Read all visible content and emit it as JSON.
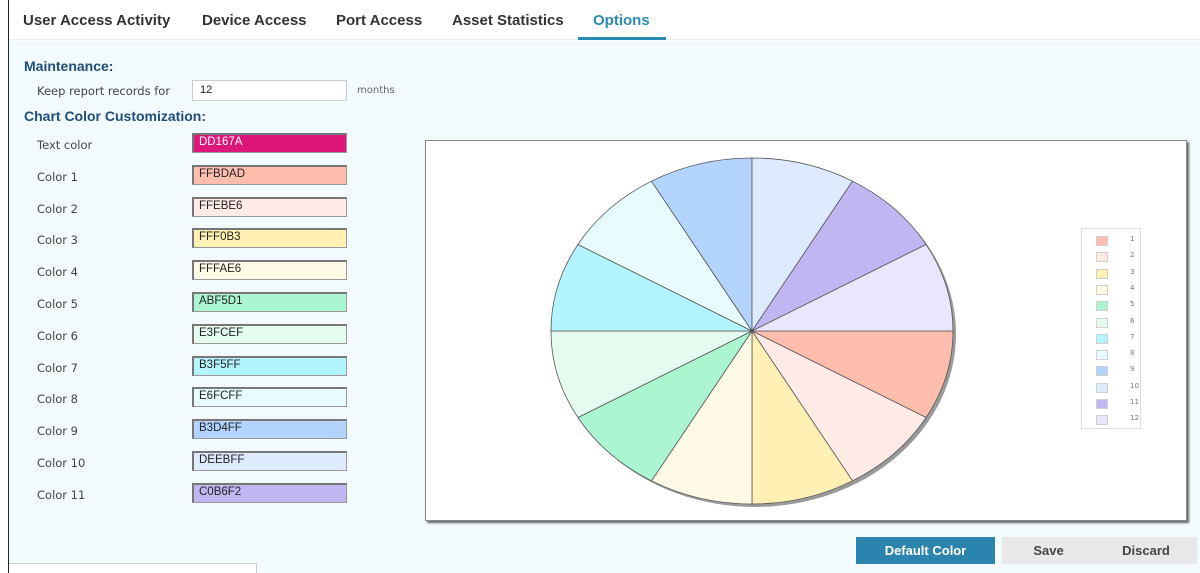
{
  "tabs": [
    {
      "label": "User Access Activity"
    },
    {
      "label": "Device Access"
    },
    {
      "label": "Port Access"
    },
    {
      "label": "Asset Statistics"
    },
    {
      "label": "Options"
    }
  ],
  "active_tab": "Options",
  "maintenance": {
    "title": "Maintenance:",
    "keep_label": "Keep report records for",
    "keep_value": "12",
    "unit": "months"
  },
  "chart_custom": {
    "title": "Chart Color Customization:",
    "text_color": {
      "label": "Text color",
      "value": "DD167A",
      "color": "#DD167A"
    },
    "colors": [
      {
        "label": "Color 1",
        "value": "FFBDAD",
        "color": "#FFBDAD"
      },
      {
        "label": "Color 2",
        "value": "FFEBE6",
        "color": "#FFEBE6"
      },
      {
        "label": "Color 3",
        "value": "FFF0B3",
        "color": "#FFF0B3"
      },
      {
        "label": "Color 4",
        "value": "FFFAE6",
        "color": "#FFFAE6"
      },
      {
        "label": "Color 5",
        "value": "ABF5D1",
        "color": "#ABF5D1"
      },
      {
        "label": "Color 6",
        "value": "E3FCEF",
        "color": "#E3FCEF"
      },
      {
        "label": "Color 7",
        "value": "B3F5FF",
        "color": "#B3F5FF"
      },
      {
        "label": "Color 8",
        "value": "E6FCFF",
        "color": "#E6FCFF"
      },
      {
        "label": "Color 9",
        "value": "B3D4FF",
        "color": "#B3D4FF"
      },
      {
        "label": "Color 10",
        "value": "DEEBFF",
        "color": "#DEEBFF"
      },
      {
        "label": "Color 11",
        "value": "C0B6F2",
        "color": "#C0B6F2"
      }
    ]
  },
  "chart_data": {
    "type": "pie",
    "categories": [
      "1",
      "2",
      "3",
      "4",
      "5",
      "6",
      "7",
      "8",
      "9",
      "10",
      "11",
      "12"
    ],
    "values": [
      1,
      1,
      1,
      1,
      1,
      1,
      1,
      1,
      1,
      1,
      1,
      1
    ],
    "colors": [
      "#FFBDAD",
      "#FFEBE6",
      "#FFF0B3",
      "#FFFAE6",
      "#ABF5D1",
      "#E3FCEF",
      "#B3F5FF",
      "#E6FCFF",
      "#B3D4FF",
      "#DEEBFF",
      "#C0B6F2",
      "#EAE6FF"
    ],
    "legend_position": "right"
  },
  "buttons": {
    "default_color": "Default Color",
    "save": "Save",
    "discard": "Discard"
  }
}
